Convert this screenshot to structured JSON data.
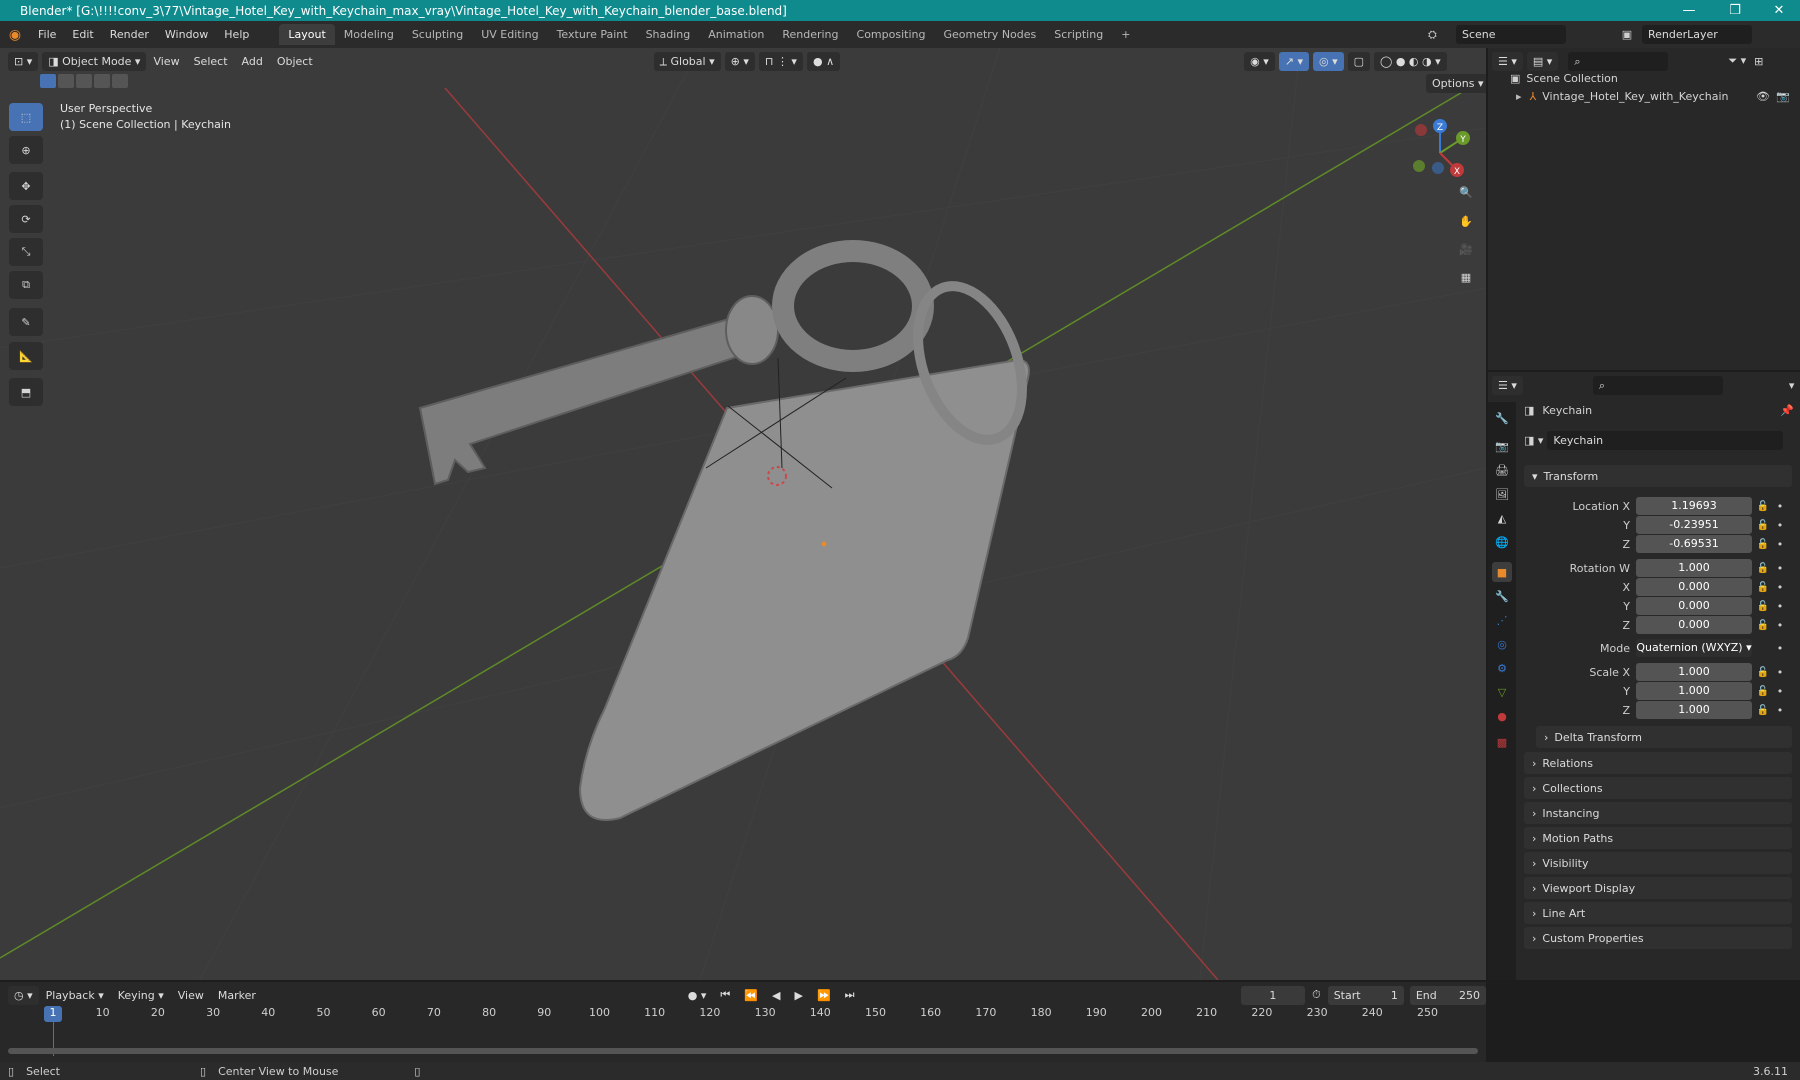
{
  "titlebar": {
    "title": "Blender* [G:\\!!!!conv_3\\77\\Vintage_Hotel_Key_with_Keychain_max_vray\\Vintage_Hotel_Key_with_Keychain_blender_base.blend]",
    "minimize": "—",
    "maximize": "❐",
    "close": "✕"
  },
  "menubar": {
    "menus": [
      "File",
      "Edit",
      "Render",
      "Window",
      "Help"
    ],
    "workspaces": [
      "Layout",
      "Modeling",
      "Sculpting",
      "UV Editing",
      "Texture Paint",
      "Shading",
      "Animation",
      "Rendering",
      "Compositing",
      "Geometry Nodes",
      "Scripting"
    ],
    "add_workspace": "+",
    "scene": "Scene",
    "view_layer": "RenderLayer"
  },
  "viewport": {
    "mode": "Object Mode",
    "menus": [
      "View",
      "Select",
      "Add",
      "Object"
    ],
    "orientation": "Global",
    "options": "Options",
    "overlay_line1": "User Perspective",
    "overlay_line2": "(1) Scene Collection | Keychain",
    "gizmo": {
      "z": "Z",
      "y": "Y",
      "x": "X"
    }
  },
  "outliner": {
    "search_placeholder": "",
    "collection": "Scene Collection",
    "object": "Vintage_Hotel_Key_with_Keychain"
  },
  "properties": {
    "object_name": "Keychain",
    "data_name": "Keychain",
    "transform_header": "Transform",
    "location_label": "Location X",
    "location": [
      "1.19693",
      "-0.23951",
      "-0.69531"
    ],
    "rotation_label": "Rotation W",
    "rotation": [
      "1.000",
      "0.000",
      "0.000",
      "0.000"
    ],
    "mode_label": "Mode",
    "mode_value": "Quaternion (WXYZ)",
    "scale_label": "Scale X",
    "scale": [
      "1.000",
      "1.000",
      "1.000"
    ],
    "axis_y": "Y",
    "axis_z": "Z",
    "axis_x": "X",
    "delta_transform": "Delta Transform",
    "panels": [
      "Relations",
      "Collections",
      "Instancing",
      "Motion Paths",
      "Visibility",
      "Viewport Display",
      "Line Art",
      "Custom Properties"
    ]
  },
  "timeline": {
    "menus": [
      "Playback",
      "Keying",
      "View",
      "Marker"
    ],
    "current_frame": "1",
    "start_label": "Start",
    "start": "1",
    "end_label": "End",
    "end": "250",
    "ticks": [
      "1",
      "10",
      "20",
      "30",
      "40",
      "50",
      "60",
      "70",
      "80",
      "90",
      "100",
      "110",
      "120",
      "130",
      "140",
      "150",
      "160",
      "170",
      "180",
      "190",
      "200",
      "210",
      "220",
      "230",
      "240",
      "250"
    ]
  },
  "statusbar": {
    "select": "Select",
    "center_view": "Center View to Mouse",
    "version": "3.6.11"
  },
  "colors": {
    "accent": "#4772b3",
    "titlebar": "#0f8a8d",
    "axis_x": "#c0393b",
    "axis_y": "#6a9a2a",
    "axis_z": "#3a7bd5",
    "object_orange": "#e8892b"
  }
}
